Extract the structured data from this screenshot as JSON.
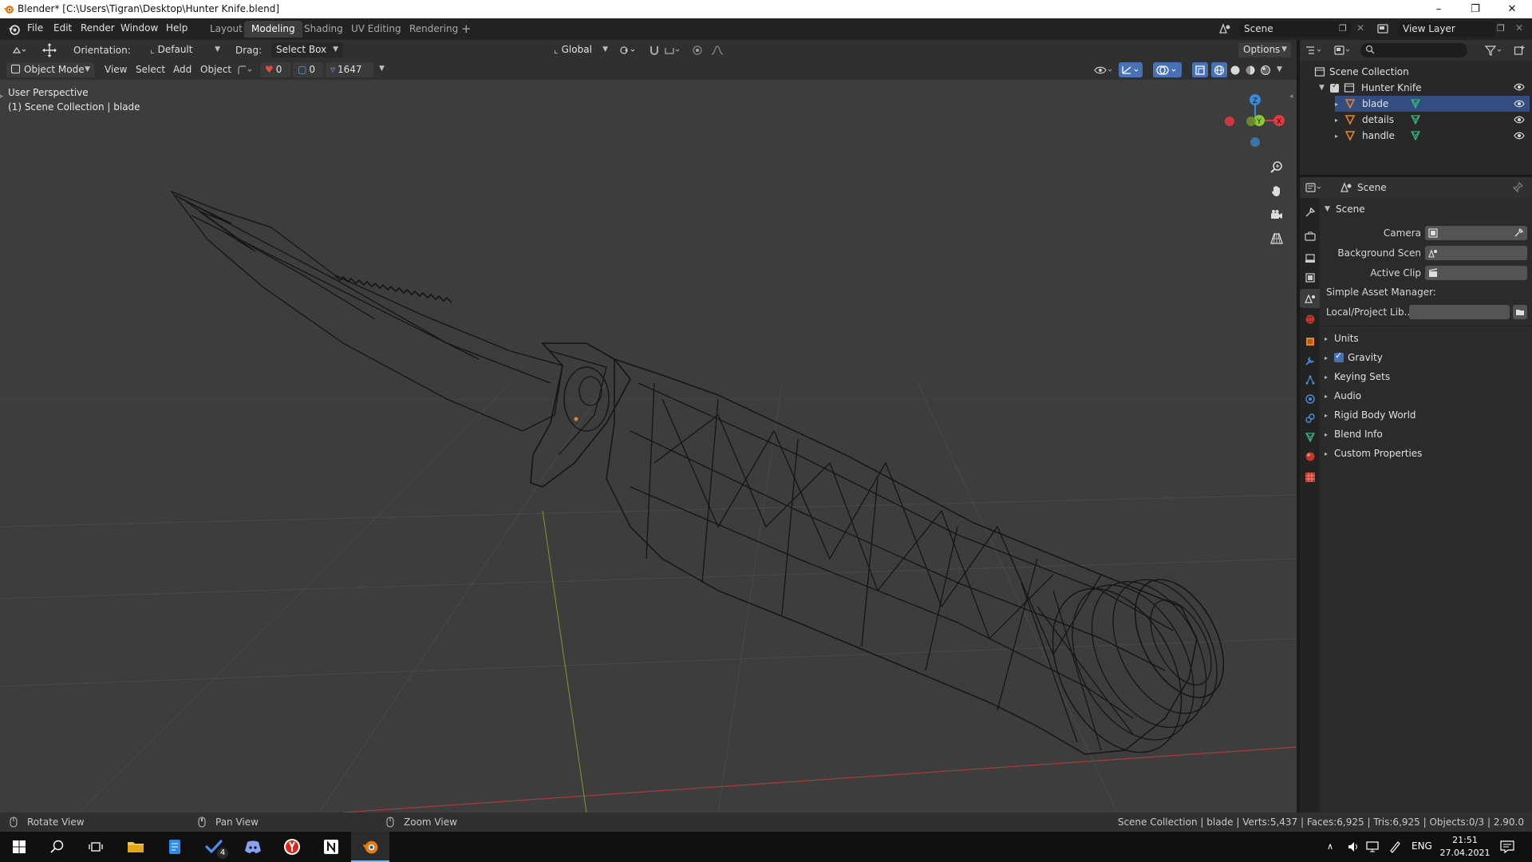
{
  "window": {
    "title": "Blender* [C:\\Users\\Tigran\\Desktop\\Hunter Knife.blend]",
    "controls": [
      "minimize",
      "restore",
      "close"
    ]
  },
  "menu": [
    "File",
    "Edit",
    "Render",
    "Window",
    "Help"
  ],
  "workspaces": [
    {
      "label": "Layout",
      "active": false
    },
    {
      "label": "Modeling",
      "active": true
    },
    {
      "label": "Shading",
      "active": false
    },
    {
      "label": "UV Editing",
      "active": false
    },
    {
      "label": "Rendering",
      "active": false
    }
  ],
  "scene_selector": {
    "scene": "Scene",
    "view_layer": "View Layer"
  },
  "tool_header": {
    "orientation_label": "Orientation:",
    "orientation_value": "Default",
    "drag_label": "Drag:",
    "drag_value": "Select Box",
    "transform_orientation": "Global",
    "options_label": "Options"
  },
  "viewport_header": {
    "mode": "Object Mode",
    "menus": [
      "View",
      "Select",
      "Add",
      "Object"
    ],
    "counts": [
      "0",
      "0",
      "1647"
    ]
  },
  "viewport": {
    "perspective": "User Perspective",
    "collection_info": "(1) Scene Collection | blade"
  },
  "gizmo": {
    "axes": {
      "z": "Z",
      "x": "X",
      "y": "Y"
    },
    "colors": {
      "x": "#e2383f",
      "y": "#8bc832",
      "z": "#3a8bd6"
    }
  },
  "outliner": {
    "search_placeholder": "",
    "root": "Scene Collection",
    "collection": "Hunter Knife",
    "objects": [
      "blade",
      "details",
      "handle"
    ]
  },
  "properties": {
    "header": "Scene",
    "panel_title": "Scene",
    "fields": [
      {
        "label": "Camera"
      },
      {
        "label": "Background Scen"
      },
      {
        "label": "Active Clip"
      }
    ],
    "asset_manager_label": "Simple Asset Manager:",
    "asset_field_label": "Local/Project Lib...",
    "subpanels": [
      {
        "label": "Units",
        "checkbox": false
      },
      {
        "label": "Gravity",
        "checkbox": true
      },
      {
        "label": "Keying Sets",
        "checkbox": false
      },
      {
        "label": "Audio",
        "checkbox": false
      },
      {
        "label": "Rigid Body World",
        "checkbox": false
      },
      {
        "label": "Blend Info",
        "checkbox": false
      },
      {
        "label": "Custom Properties",
        "checkbox": false
      }
    ]
  },
  "status_bar": {
    "hints": [
      "Rotate View",
      "Pan View",
      "Zoom View"
    ],
    "stats": "Scene Collection | blade | Verts:5,437 | Faces:6,925 | Tris:6,925 | Objects:0/3 | 2.90.0"
  },
  "taskbar": {
    "lang": "ENG",
    "time": "21:51",
    "date": "27.04.2021",
    "badge": "4"
  },
  "colors": {
    "accent": "#4772b3",
    "viewport_bg": "#3d3d3d",
    "orange": "#e8822a"
  }
}
